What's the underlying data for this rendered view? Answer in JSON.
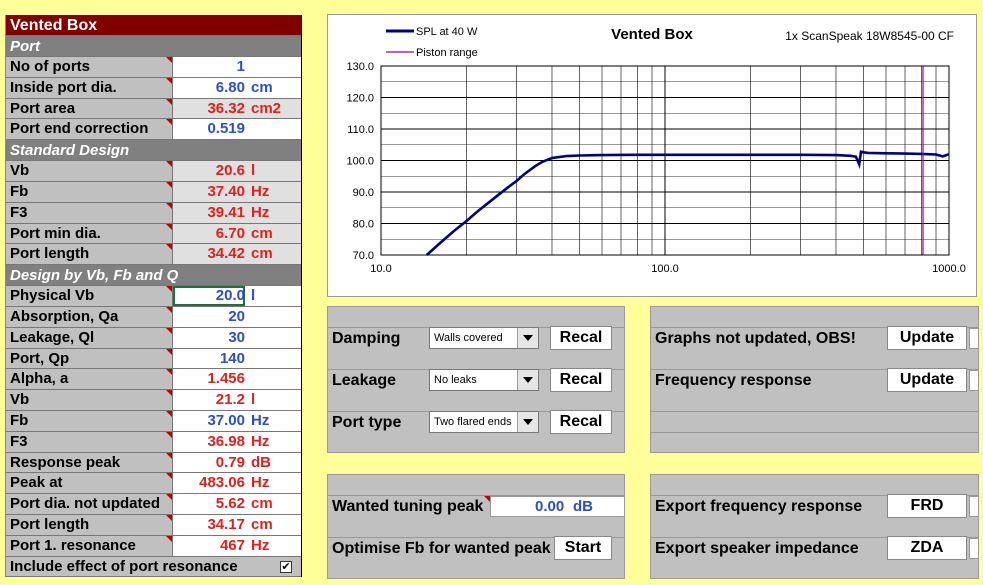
{
  "left": {
    "title": "Vented Box",
    "sections": {
      "port": "Port",
      "standard": "Standard Design",
      "design": "Design by Vb, Fb and Q"
    },
    "rows": {
      "no_of_ports": {
        "label": "No of ports",
        "value": "1",
        "unit": ""
      },
      "inside_port_dia": {
        "label": "Inside port dia.",
        "value": "6.80",
        "unit": "cm"
      },
      "port_area": {
        "label": "Port area",
        "value": "36.32",
        "unit": "cm2"
      },
      "port_end_corr": {
        "label": "Port end correction",
        "value": "0.519",
        "unit": ""
      },
      "vb1": {
        "label": "Vb",
        "value": "20.6",
        "unit": "l"
      },
      "fb1": {
        "label": "Fb",
        "value": "37.40",
        "unit": "Hz"
      },
      "f3_1": {
        "label": "F3",
        "value": "39.41",
        "unit": "Hz"
      },
      "port_min_dia": {
        "label": "Port min dia.",
        "value": "6.70",
        "unit": "cm"
      },
      "port_length1": {
        "label": "Port length",
        "value": "34.42",
        "unit": "cm"
      },
      "physical_vb": {
        "label": "Physical Vb",
        "value": "20.0",
        "unit": "l"
      },
      "absorption": {
        "label": "Absorption, Qa",
        "value": "20",
        "unit": ""
      },
      "leakage": {
        "label": "Leakage, Ql",
        "value": "30",
        "unit": ""
      },
      "port_qp": {
        "label": "Port, Qp",
        "value": "140",
        "unit": ""
      },
      "alpha": {
        "label": "Alpha, a",
        "value": "1.456",
        "unit": ""
      },
      "vb2": {
        "label": "Vb",
        "value": "21.2",
        "unit": "l"
      },
      "fb2": {
        "label": "Fb",
        "value": "37.00",
        "unit": "Hz"
      },
      "f3_2": {
        "label": "F3",
        "value": "36.98",
        "unit": "Hz"
      },
      "resp_peak": {
        "label": "Response peak",
        "value": "0.79",
        "unit": "dB"
      },
      "peak_at": {
        "label": "Peak at",
        "value": "483.06",
        "unit": "Hz"
      },
      "port_dia_nu": {
        "label": "Port dia. not updated",
        "value": "5.62",
        "unit": "cm"
      },
      "port_length2": {
        "label": "Port length",
        "value": "34.17",
        "unit": "cm"
      },
      "port_res": {
        "label": "Port 1. resonance",
        "value": "467",
        "unit": "Hz"
      }
    },
    "include_label": "Include effect of port resonance",
    "include_checked": "✔"
  },
  "controls": {
    "damping_label": "Damping",
    "damping_value": "Walls covered",
    "leakage_label": "Leakage",
    "leakage_value": "No leaks",
    "porttype_label": "Port type",
    "porttype_value": "Two flared ends",
    "recal": "Recal",
    "graphs_label": "Graphs not updated, OBS!",
    "freq_label": "Frequency response",
    "update": "Update",
    "wanted_label": "Wanted tuning peak",
    "wanted_value": "0.00",
    "wanted_unit": "dB",
    "optimise_label": "Optimise Fb for wanted peak",
    "start": "Start",
    "export_fr_label": "Export frequency response",
    "frd": "FRD",
    "export_imp_label": "Export speaker impedance",
    "zda": "ZDA"
  },
  "chart_data": {
    "type": "line",
    "title": "Vented Box",
    "subtitle": "1x ScanSpeak 18W8545-00 CF",
    "x_scale": "log",
    "xlim": [
      10,
      1000
    ],
    "x_ticks": [
      "10.0",
      "100.0",
      "1000.0"
    ],
    "ylim": [
      70,
      130
    ],
    "y_ticks": [
      "70.0",
      "80.0",
      "90.0",
      "100.0",
      "110.0",
      "120.0",
      "130.0"
    ],
    "grid": true,
    "legend": "top-left",
    "series": [
      {
        "name": "SPL at 40 W",
        "color": "#000080",
        "x": [
          14.5,
          16,
          18,
          20,
          22,
          25,
          28,
          30,
          32,
          35,
          37,
          40,
          45,
          50,
          60,
          80,
          100,
          150,
          200,
          300,
          400,
          450,
          470,
          483,
          490,
          500,
          520,
          600,
          700,
          800,
          900,
          950,
          1000
        ],
        "y": [
          70,
          73.5,
          77.5,
          80.8,
          84,
          88,
          91.5,
          93.5,
          95.7,
          98.3,
          99.6,
          100.8,
          101.4,
          101.6,
          101.7,
          101.8,
          101.8,
          101.8,
          101.8,
          101.8,
          101.7,
          101.5,
          101.2,
          98.8,
          102.8,
          102.6,
          102.4,
          102.3,
          102.2,
          102.1,
          101.9,
          101.3,
          102.0
        ]
      },
      {
        "name": "Piston range",
        "color": "#a0008c",
        "x": [
          810,
          810
        ],
        "y": [
          70,
          130
        ]
      }
    ]
  }
}
